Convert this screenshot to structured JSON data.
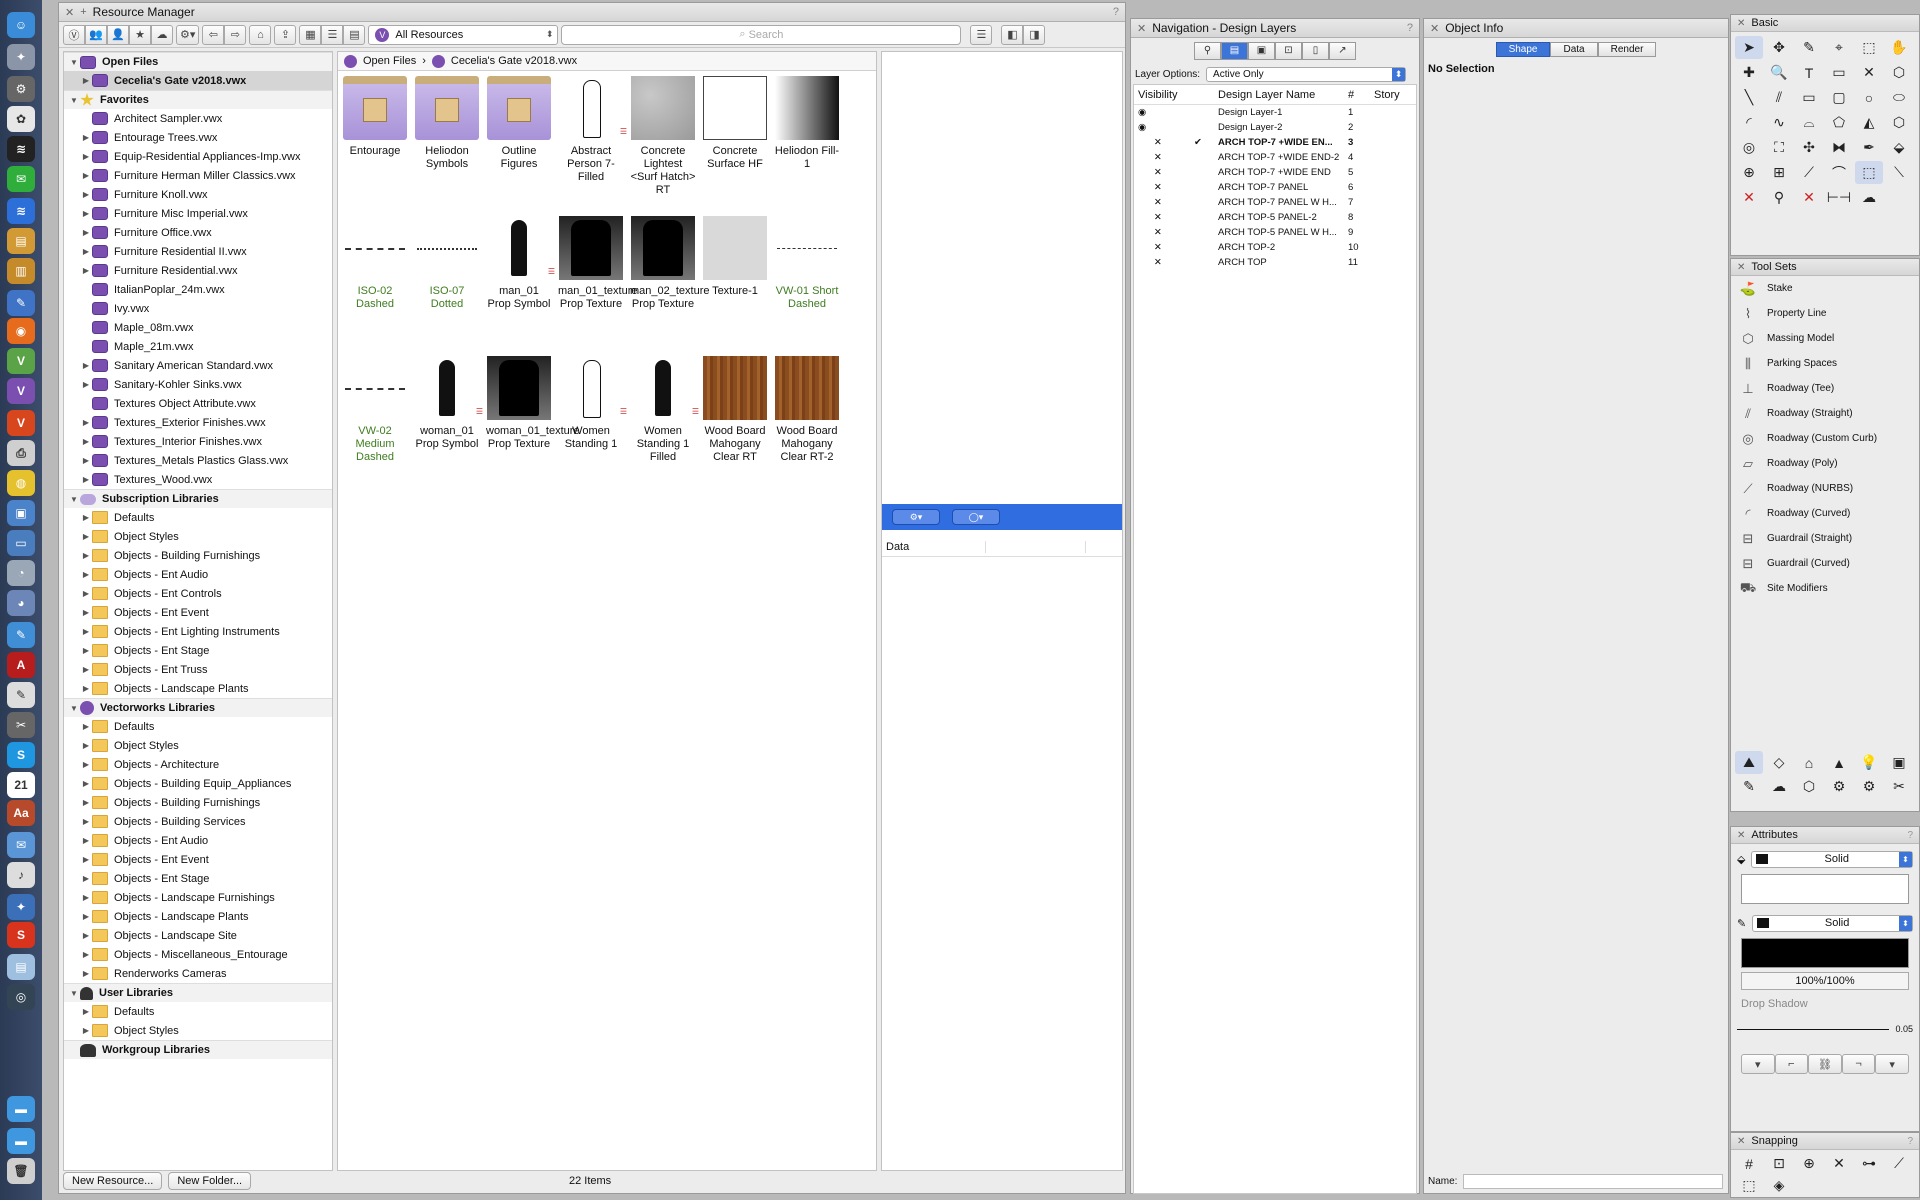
{
  "resource_manager": {
    "title": "Resource Manager",
    "filter_label": "All Resources",
    "search_placeholder": "Search",
    "breadcrumb": {
      "root": "Open Files",
      "file": "Cecelia's Gate v2018.vwx"
    },
    "tree": [
      {
        "label": "Open Files",
        "type": "section",
        "icon": "vw",
        "open": true
      },
      {
        "label": "Cecelia's Gate v2018.vwx",
        "type": "file",
        "indent": 1,
        "selected": true,
        "arrow": true
      },
      {
        "label": "Favorites",
        "type": "section",
        "icon": "star",
        "open": true
      },
      {
        "label": "Architect Sampler.vwx",
        "type": "file",
        "indent": 1
      },
      {
        "label": "Entourage Trees.vwx",
        "type": "file",
        "indent": 1,
        "arrow": true
      },
      {
        "label": "Equip-Residential Appliances-Imp.vwx",
        "type": "file",
        "indent": 1,
        "arrow": true
      },
      {
        "label": "Furniture Herman Miller Classics.vwx",
        "type": "file",
        "indent": 1,
        "arrow": true
      },
      {
        "label": "Furniture Knoll.vwx",
        "type": "file",
        "indent": 1,
        "arrow": true
      },
      {
        "label": "Furniture Misc Imperial.vwx",
        "type": "file",
        "indent": 1,
        "arrow": true
      },
      {
        "label": "Furniture Office.vwx",
        "type": "file",
        "indent": 1,
        "arrow": true
      },
      {
        "label": "Furniture Residential II.vwx",
        "type": "file",
        "indent": 1,
        "arrow": true
      },
      {
        "label": "Furniture Residential.vwx",
        "type": "file",
        "indent": 1,
        "arrow": true
      },
      {
        "label": "ItalianPoplar_24m.vwx",
        "type": "file",
        "indent": 1
      },
      {
        "label": "Ivy.vwx",
        "type": "file",
        "indent": 1
      },
      {
        "label": "Maple_08m.vwx",
        "type": "file",
        "indent": 1
      },
      {
        "label": "Maple_21m.vwx",
        "type": "file",
        "indent": 1
      },
      {
        "label": "Sanitary American Standard.vwx",
        "type": "file",
        "indent": 1,
        "arrow": true
      },
      {
        "label": "Sanitary-Kohler Sinks.vwx",
        "type": "file",
        "indent": 1,
        "arrow": true
      },
      {
        "label": "Textures Object Attribute.vwx",
        "type": "file",
        "indent": 1
      },
      {
        "label": "Textures_Exterior Finishes.vwx",
        "type": "file",
        "indent": 1,
        "arrow": true
      },
      {
        "label": "Textures_Interior Finishes.vwx",
        "type": "file",
        "indent": 1,
        "arrow": true
      },
      {
        "label": "Textures_Metals Plastics Glass.vwx",
        "type": "file",
        "indent": 1,
        "arrow": true
      },
      {
        "label": "Textures_Wood.vwx",
        "type": "file",
        "indent": 1,
        "arrow": true
      },
      {
        "label": "Subscription Libraries",
        "type": "section",
        "icon": "cloud",
        "open": true
      },
      {
        "label": "Defaults",
        "type": "folder",
        "indent": 1,
        "arrow": true
      },
      {
        "label": "Object Styles",
        "type": "folder",
        "indent": 1,
        "arrow": true
      },
      {
        "label": "Objects - Building Furnishings",
        "type": "folder",
        "indent": 1,
        "arrow": true
      },
      {
        "label": "Objects - Ent Audio",
        "type": "folder",
        "indent": 1,
        "arrow": true
      },
      {
        "label": "Objects - Ent Controls",
        "type": "folder",
        "indent": 1,
        "arrow": true
      },
      {
        "label": "Objects - Ent Event",
        "type": "folder",
        "indent": 1,
        "arrow": true
      },
      {
        "label": "Objects - Ent Lighting Instruments",
        "type": "folder",
        "indent": 1,
        "arrow": true
      },
      {
        "label": "Objects - Ent Stage",
        "type": "folder",
        "indent": 1,
        "arrow": true
      },
      {
        "label": "Objects - Ent Truss",
        "type": "folder",
        "indent": 1,
        "arrow": true
      },
      {
        "label": "Objects - Landscape Plants",
        "type": "folder",
        "indent": 1,
        "arrow": true
      },
      {
        "label": "Vectorworks Libraries",
        "type": "section",
        "icon": "vwsec",
        "open": true
      },
      {
        "label": "Defaults",
        "type": "folder",
        "indent": 1,
        "arrow": true
      },
      {
        "label": "Object Styles",
        "type": "folder",
        "indent": 1,
        "arrow": true
      },
      {
        "label": "Objects - Architecture",
        "type": "folder",
        "indent": 1,
        "arrow": true
      },
      {
        "label": "Objects - Building Equip_Appliances",
        "type": "folder",
        "indent": 1,
        "arrow": true
      },
      {
        "label": "Objects - Building Furnishings",
        "type": "folder",
        "indent": 1,
        "arrow": true
      },
      {
        "label": "Objects - Building Services",
        "type": "folder",
        "indent": 1,
        "arrow": true
      },
      {
        "label": "Objects - Ent Audio",
        "type": "folder",
        "indent": 1,
        "arrow": true
      },
      {
        "label": "Objects - Ent Event",
        "type": "folder",
        "indent": 1,
        "arrow": true
      },
      {
        "label": "Objects - Ent Stage",
        "type": "folder",
        "indent": 1,
        "arrow": true
      },
      {
        "label": "Objects - Landscape Furnishings",
        "type": "folder",
        "indent": 1,
        "arrow": true
      },
      {
        "label": "Objects - Landscape Plants",
        "type": "folder",
        "indent": 1,
        "arrow": true
      },
      {
        "label": "Objects - Landscape Site",
        "type": "folder",
        "indent": 1,
        "arrow": true
      },
      {
        "label": "Objects - Miscellaneous_Entourage",
        "type": "folder",
        "indent": 1,
        "arrow": true
      },
      {
        "label": "Renderworks Cameras",
        "type": "folder",
        "indent": 1,
        "arrow": true
      },
      {
        "label": "User Libraries",
        "type": "section",
        "icon": "user",
        "open": true
      },
      {
        "label": "Defaults",
        "type": "folder",
        "indent": 1,
        "arrow": true
      },
      {
        "label": "Object Styles",
        "type": "folder",
        "indent": 1,
        "arrow": true
      },
      {
        "label": "Workgroup Libraries",
        "type": "section",
        "icon": "group",
        "open": false
      }
    ],
    "resources": [
      {
        "label": "Entourage",
        "thumb": "folder"
      },
      {
        "label": "Heliodon Symbols",
        "thumb": "folder"
      },
      {
        "label": "Outline Figures",
        "thumb": "folder"
      },
      {
        "label": "Abstract Person 7-Filled",
        "thumb": "person outline",
        "badge": true
      },
      {
        "label": "Concrete Lightest <Surf Hatch> RT",
        "thumb": "concrete"
      },
      {
        "label": "Concrete Surface HF",
        "thumb": "white"
      },
      {
        "label": "Heliodon Fill-1",
        "thumb": "grad"
      },
      {
        "label": "ISO-02 Dashed",
        "thumb": "line",
        "green": true
      },
      {
        "label": "ISO-07 Dotted",
        "thumb": "line dotted",
        "green": true
      },
      {
        "label": "man_01 Prop Symbol",
        "thumb": "person",
        "badge": true
      },
      {
        "label": "man_01_texture Prop Texture",
        "thumb": "persontex"
      },
      {
        "label": "man_02_texture Prop Texture",
        "thumb": "persontex"
      },
      {
        "label": "Texture-1",
        "thumb": "texture"
      },
      {
        "label": "VW-01 Short Dashed",
        "thumb": "line short",
        "green": true
      },
      {
        "label": "VW-02 Medium Dashed",
        "thumb": "line",
        "green": true
      },
      {
        "label": "woman_01 Prop Symbol",
        "thumb": "person",
        "badge": true
      },
      {
        "label": "woman_01_texture Prop Texture",
        "thumb": "persontex"
      },
      {
        "label": "Women Standing 1",
        "thumb": "person outline",
        "badge": true
      },
      {
        "label": "Women Standing 1 Filled",
        "thumb": "person",
        "badge": true
      },
      {
        "label": "Wood Board Mahogany Clear RT",
        "thumb": "wood"
      },
      {
        "label": "Wood Board Mahogany Clear RT-2",
        "thumb": "wood"
      }
    ],
    "preview_data_label": "Data",
    "new_resource_label": "New Resource...",
    "new_folder_label": "New Folder...",
    "item_count": "22 Items"
  },
  "navigation": {
    "title": "Navigation - Design Layers",
    "layer_options_label": "Layer Options:",
    "layer_options_value": "Active Only",
    "columns": {
      "visibility": "Visibility",
      "name": "Design Layer Name",
      "num": "#",
      "story": "Story"
    },
    "layers": [
      {
        "name": "Design Layer-1",
        "num": "1",
        "vis": "eye"
      },
      {
        "name": "Design Layer-2",
        "num": "2",
        "vis": "eye"
      },
      {
        "name": "ARCH TOP-7 +WIDE EN...",
        "num": "3",
        "vis": "x",
        "active": true
      },
      {
        "name": "ARCH TOP-7 +WIDE END-2",
        "num": "4",
        "vis": "x"
      },
      {
        "name": "ARCH TOP-7 +WIDE END",
        "num": "5",
        "vis": "x"
      },
      {
        "name": "ARCH TOP-7 PANEL",
        "num": "6",
        "vis": "x"
      },
      {
        "name": "ARCH TOP-7 PANEL W H...",
        "num": "7",
        "vis": "x"
      },
      {
        "name": "ARCH TOP-5 PANEL-2",
        "num": "8",
        "vis": "x"
      },
      {
        "name": "ARCH TOP-5 PANEL W H...",
        "num": "9",
        "vis": "x"
      },
      {
        "name": "ARCH TOP-2",
        "num": "10",
        "vis": "x"
      },
      {
        "name": "ARCH TOP",
        "num": "11",
        "vis": "x"
      }
    ]
  },
  "object_info": {
    "title": "Object Info",
    "tabs": [
      "Shape",
      "Data",
      "Render"
    ],
    "selection": "No Selection",
    "name_label": "Name:"
  },
  "basic": {
    "title": "Basic"
  },
  "tool_sets": {
    "title": "Tool Sets",
    "items": [
      "Stake",
      "Property Line",
      "Massing Model",
      "Parking Spaces",
      "Roadway (Tee)",
      "Roadway (Straight)",
      "Roadway (Custom Curb)",
      "Roadway (Poly)",
      "Roadway (NURBS)",
      "Roadway (Curved)",
      "Guardrail (Straight)",
      "Guardrail (Curved)",
      "Site Modifiers"
    ]
  },
  "attributes": {
    "title": "Attributes",
    "fill_style": "Solid",
    "pen_style": "Solid",
    "opacity": "100%/100%",
    "drop_shadow": "Drop Shadow",
    "line_weight": "0.05"
  },
  "snapping": {
    "title": "Snapping"
  },
  "colors": {
    "accent": "#3d74d8",
    "vectorworks_purple": "#7a4fb0",
    "folder_yellow": "#f3c75a",
    "linetype_green": "#3e7d1f"
  }
}
